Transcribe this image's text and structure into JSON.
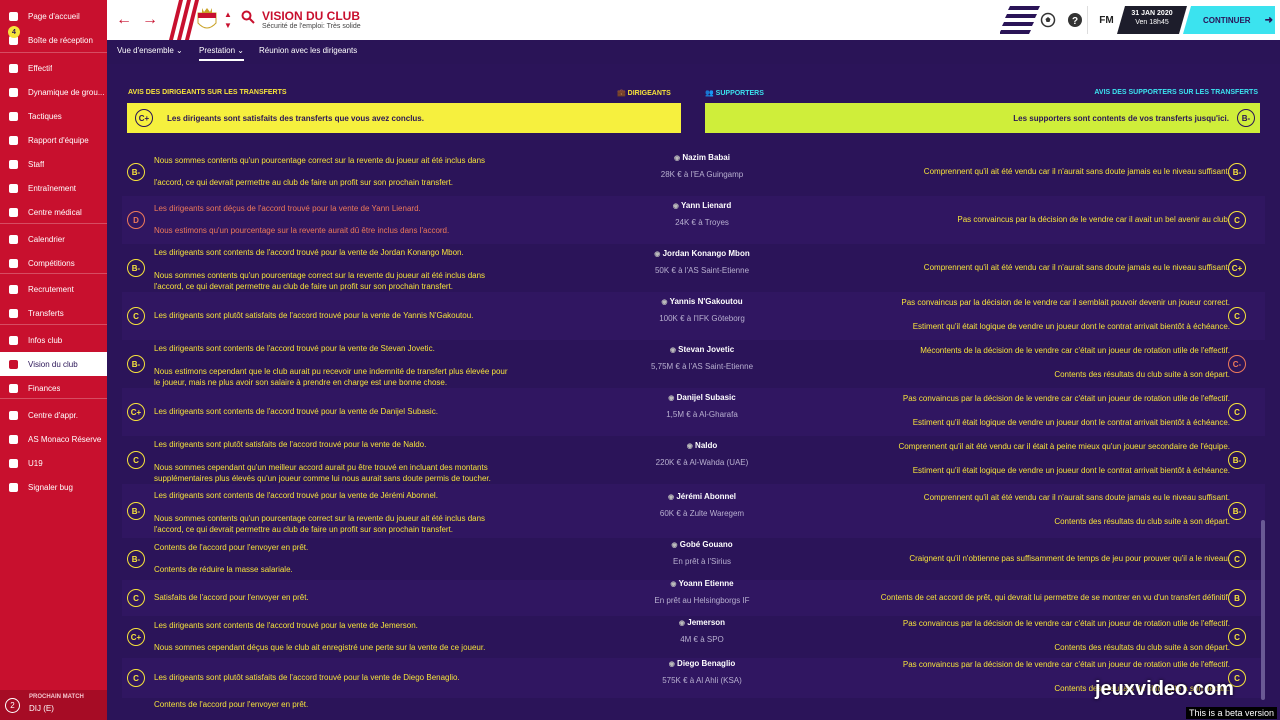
{
  "sidebar": {
    "inbox_badge": "4",
    "items": [
      {
        "label": "Page d'accueil",
        "icon": "home-icon"
      },
      {
        "label": "Boîte de réception",
        "icon": "mail-icon"
      },
      {
        "label": "Effectif",
        "icon": "people-icon"
      },
      {
        "label": "Dynamique de grou...",
        "icon": "dynamics-icon"
      },
      {
        "label": "Tactiques",
        "icon": "tactics-icon"
      },
      {
        "label": "Rapport d'équipe",
        "icon": "report-icon"
      },
      {
        "label": "Staff",
        "icon": "staff-icon"
      },
      {
        "label": "Entraînement",
        "icon": "training-icon"
      },
      {
        "label": "Centre médical",
        "icon": "medical-icon"
      },
      {
        "label": "Calendrier",
        "icon": "calendar-icon"
      },
      {
        "label": "Compétitions",
        "icon": "trophy-icon"
      },
      {
        "label": "Recrutement",
        "icon": "scouting-icon"
      },
      {
        "label": "Transferts",
        "icon": "transfers-icon"
      },
      {
        "label": "Infos club",
        "icon": "shield-icon"
      },
      {
        "label": "Vision du club",
        "icon": "vision-icon"
      },
      {
        "label": "Finances",
        "icon": "finances-icon"
      },
      {
        "label": "Centre d'appr.",
        "icon": "academy-icon"
      },
      {
        "label": "AS Monaco Réserve",
        "icon": "reserve-icon"
      },
      {
        "label": "U19",
        "icon": "u19-icon"
      },
      {
        "label": "Signaler bug",
        "icon": "bug-icon"
      }
    ],
    "next_match": {
      "label": "PROCHAIN MATCH",
      "value": "DIJ (E)",
      "badge": "2"
    }
  },
  "header": {
    "title": "VISION DU CLUB",
    "subtitle": "Sécurité de l'emploi: Très solide",
    "fm": "FM",
    "date": "31 JAN 2020",
    "time": "Ven 18h45",
    "continue": "CONTINUER"
  },
  "tabs": [
    "Vue d'ensemble",
    "Prestation",
    "Réunion avec les dirigeants"
  ],
  "board": {
    "heading": "AVIS DES DIRIGEANTS SUR LES TRANSFERTS",
    "tag": "DIRIGEANTS",
    "grade": "C+",
    "message": "Les dirigeants sont satisfaits des transferts que vous avez conclus."
  },
  "supporters": {
    "tag": "SUPPORTERS",
    "heading": "AVIS DES SUPPORTERS SUR LES TRANSFERTS",
    "grade": "B-",
    "message": "Les supporters sont contents de vos transferts jusqu'ici."
  },
  "transfers": [
    {
      "grade": "B-",
      "board": [
        "Nous sommes contents qu'un pourcentage correct sur la revente du joueur ait été inclus dans",
        "l'accord, ce qui devrait permettre au club de faire un profit sur son prochain transfert."
      ],
      "name": "Nazim Babai",
      "fee": "28K € à l'EA Guingamp",
      "fans": [
        "Comprennent qu'il ait été vendu car il n'aurait sans doute jamais eu le niveau suffisant."
      ],
      "fan_grade": "B-"
    },
    {
      "grade": "D",
      "board": [
        "Les dirigeants sont déçus de l'accord trouvé pour la vente de Yann Lienard.",
        "Nous estimons qu'un pourcentage sur la revente aurait dû être inclus dans l'accord."
      ],
      "name": "Yann Lienard",
      "fee": "24K € à Troyes",
      "fans": [
        "Pas convaincus par la décision de le vendre car il avait un bel avenir au club."
      ],
      "fan_grade": "C"
    },
    {
      "grade": "B-",
      "board": [
        "Les dirigeants sont contents de l'accord trouvé pour la vente de Jordan Konango Mbon.",
        "Nous sommes contents qu'un pourcentage correct sur la revente du joueur ait été inclus dans",
        "l'accord, ce qui devrait permettre au club de faire un profit sur son prochain transfert."
      ],
      "name": "Jordan Konango Mbon",
      "fee": "50K € à l'AS Saint-Etienne",
      "fans": [
        "Comprennent qu'il ait été vendu car il n'aurait sans doute jamais eu le niveau suffisant."
      ],
      "fan_grade": "C+"
    },
    {
      "grade": "C",
      "board": [
        "Les dirigeants sont plutôt satisfaits de l'accord trouvé pour la vente de Yannis N'Gakoutou."
      ],
      "name": "Yannis N'Gakoutou",
      "fee": "100K € à l'IFK Göteborg",
      "fans": [
        "Pas convaincus par la décision de le vendre car il semblait pouvoir devenir un joueur correct.",
        "Estiment qu'il était logique de vendre un joueur dont le contrat arrivait bientôt à échéance."
      ],
      "fan_grade": "C"
    },
    {
      "grade": "B-",
      "board": [
        "Les dirigeants sont contents de l'accord trouvé pour la vente de Stevan Jovetic.",
        "Nous estimons cependant que le club aurait pu recevoir une indemnité de transfert plus élevée pour",
        "le joueur, mais ne plus avoir son salaire à prendre en charge est une bonne chose."
      ],
      "name": "Stevan Jovetic",
      "fee": "5,75M € à l'AS Saint-Etienne",
      "fans": [
        "Mécontents de la décision de le vendre car c'était un joueur de rotation utile de l'effectif.",
        "Contents des résultats du club suite à son départ."
      ],
      "fan_grade": "C-"
    },
    {
      "grade": "C+",
      "board": [
        "Les dirigeants sont contents de l'accord trouvé pour la vente de Danijel Subasic."
      ],
      "name": "Danijel Subasic",
      "fee": "1,5M € à Al-Gharafa",
      "fans": [
        "Pas convaincus par la décision de le vendre car c'était un joueur de rotation utile de l'effectif.",
        "Estiment qu'il était logique de vendre un joueur dont le contrat arrivait bientôt à échéance."
      ],
      "fan_grade": "C"
    },
    {
      "grade": "C",
      "board": [
        "Les dirigeants sont plutôt satisfaits de l'accord trouvé pour la vente de Naldo.",
        "Nous sommes cependant qu'un meilleur accord aurait pu être trouvé en incluant des montants",
        "supplémentaires plus élevés qu'un joueur comme lui nous aurait sans doute permis de toucher."
      ],
      "name": "Naldo",
      "fee": "220K € à Al-Wahda (UAE)",
      "fans": [
        "Comprennent qu'il ait été vendu car il était à peine mieux qu'un joueur secondaire de l'équipe.",
        "Estiment qu'il était logique de vendre un joueur dont le contrat arrivait bientôt à échéance."
      ],
      "fan_grade": "B-"
    },
    {
      "grade": "B-",
      "board": [
        "Les dirigeants sont contents de l'accord trouvé pour la vente de Jérémi Abonnel.",
        "Nous sommes contents qu'un pourcentage correct sur la revente du joueur ait été inclus dans",
        "l'accord, ce qui devrait permettre au club de faire un profit sur son prochain transfert."
      ],
      "name": "Jérémi Abonnel",
      "fee": "60K € à Zulte Waregem",
      "fans": [
        "Comprennent qu'il ait été vendu car il n'aurait sans doute jamais eu le niveau suffisant.",
        "Contents des résultats du club suite à son départ."
      ],
      "fan_grade": "B-"
    },
    {
      "grade": "B-",
      "board": [
        "Contents de l'accord pour l'envoyer en prêt.",
        "Contents de réduire la masse salariale."
      ],
      "name": "Gobé Gouano",
      "fee": "En prêt à l'Sirius",
      "fans": [
        "Craignent qu'il n'obtienne pas suffisamment de temps de jeu pour prouver qu'il a le niveau."
      ],
      "fan_grade": "C"
    },
    {
      "grade": "C",
      "board": [
        "Satisfaits de l'accord pour l'envoyer en prêt."
      ],
      "name": "Yoann Etienne",
      "fee": "En prêt au Helsingborgs IF",
      "fans": [
        "Contents de cet accord de prêt, qui devrait lui permettre de se montrer en vu d'un transfert définitif."
      ],
      "fan_grade": "B"
    },
    {
      "grade": "C+",
      "board": [
        "Les dirigeants sont contents de l'accord trouvé pour la vente de Jemerson.",
        "Nous sommes cependant déçus que le club ait enregistré une perte sur la vente de ce joueur."
      ],
      "name": "Jemerson",
      "fee": "4M € à SPO",
      "fans": [
        "Pas convaincus par la décision de le vendre car c'était un joueur de rotation utile de l'effectif.",
        "Contents des résultats du club suite à son départ."
      ],
      "fan_grade": "C"
    },
    {
      "grade": "C",
      "board": [
        "Les dirigeants sont plutôt satisfaits de l'accord trouvé pour la vente de Diego Benaglio."
      ],
      "name": "Diego Benaglio",
      "fee": "575K € à Al Ahli (KSA)",
      "fans": [
        "Pas convaincus par la décision de le vendre car c'était un joueur de rotation utile de l'effectif.",
        "Contents des résultats du club suite à son départ."
      ],
      "fan_grade": "C"
    },
    {
      "grade": "",
      "board": [
        "Contents de l'accord pour l'envoyer en prêt."
      ],
      "name": "",
      "fee": "",
      "fans": [],
      "fan_grade": ""
    }
  ],
  "watermark": "jeuxvideo.com",
  "beta_note": "This is a beta version"
}
